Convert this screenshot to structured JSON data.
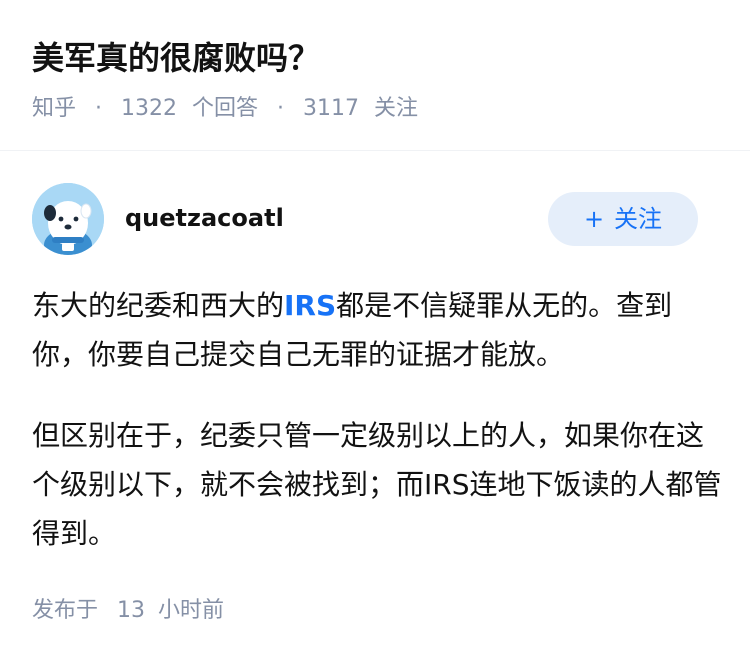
{
  "question": {
    "title": "美军真的很腐败吗？",
    "source": "知乎",
    "answer_count": "1322",
    "answer_label": "个回答",
    "follower_count": "3117",
    "follower_label": "关注",
    "separator": "·"
  },
  "author": {
    "name": "quetzacoatl",
    "avatar_icon": "avatar-dog-icon",
    "follow_button": {
      "plus": "+",
      "label": "关注"
    }
  },
  "answer": {
    "paragraph1": {
      "before": "东大的纪委和西大的",
      "link": "IRS",
      "after": "都是不信疑罪从无的。查到你，你要自己提交自己无罪的证据才能放。"
    },
    "paragraph2": "但区别在于，纪委只管一定级别以上的人，如果你在这个级别以下，就不会被找到；而IRS连地下饭读的人都管得到。"
  },
  "footer": {
    "publish_label": "发布于",
    "time_value": "13",
    "time_unit": "小时前"
  },
  "colors": {
    "accent": "#1772f6",
    "meta": "#8590a6",
    "follow_bg": "#e5eefa",
    "avatar_bg": "#a9d8f5"
  }
}
